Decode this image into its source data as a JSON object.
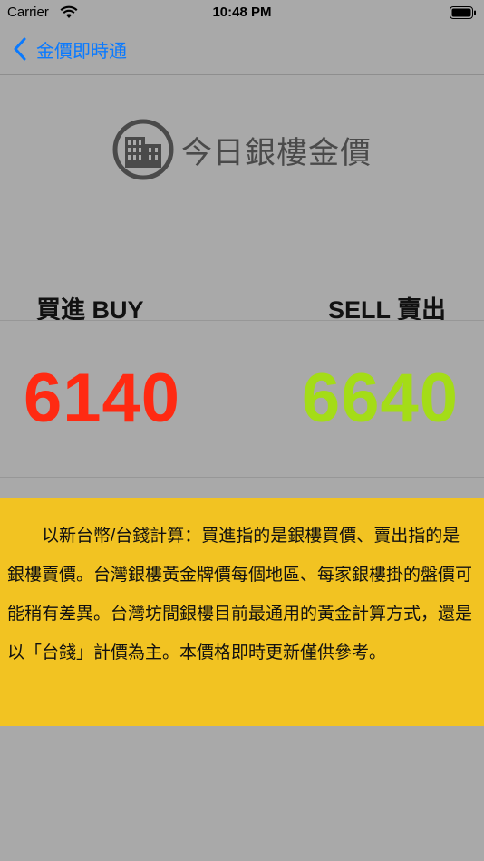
{
  "status_bar": {
    "carrier": "Carrier",
    "time": "10:48 PM"
  },
  "nav": {
    "back_label": "金價即時通"
  },
  "logo": {
    "title": "今日銀樓金價",
    "icon": "building-icon"
  },
  "prices": {
    "buy_label": "買進 BUY",
    "sell_label": "SELL 賣出",
    "buy_value": "6140",
    "sell_value": "6640",
    "buy_color": "#ff2a12",
    "sell_color": "#a4dc17"
  },
  "info": {
    "text": "以新台幣/台錢計算：買進指的是銀樓買價、賣出指的是銀樓賣價。台灣銀樓黃金牌價每個地區、每家銀樓掛的盤價可能稍有差異。台灣坊間銀樓目前最通用的黃金計算方式，還是以「台錢」計價為主。本價格即時更新僅供參考。",
    "background": "#f2c322"
  },
  "colors": {
    "background": "#a9a9a9",
    "accent": "#0a7aff"
  }
}
